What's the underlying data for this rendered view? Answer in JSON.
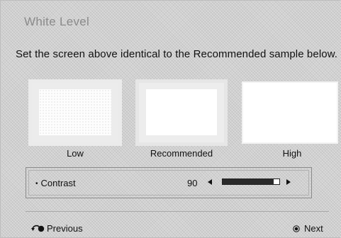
{
  "title": "White Level",
  "instruction": "Set the screen above identical to the Recommended sample below.",
  "samples": [
    {
      "label": "Low"
    },
    {
      "label": "Recommended"
    },
    {
      "label": "High"
    }
  ],
  "contrast": {
    "label": "Contrast",
    "value": "90",
    "level_fraction": 0.9
  },
  "nav": {
    "previous": "Previous",
    "next": "Next"
  },
  "icons": {
    "previous": "return-icon",
    "next": "ok-button-icon",
    "decrease": "triangle-left-icon",
    "increase": "triangle-right-icon"
  }
}
